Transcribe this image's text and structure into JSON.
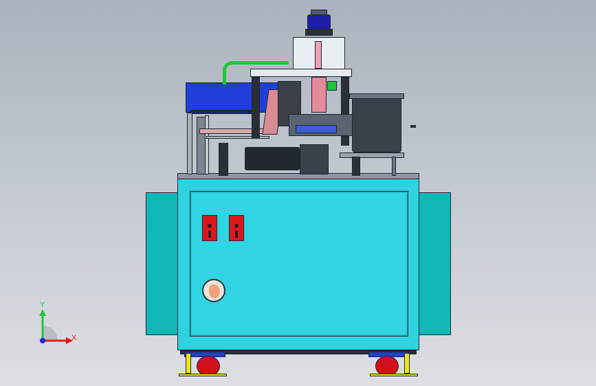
{
  "viewport": {
    "name": "cad-machine-front-view",
    "background_top": "#aab2bd",
    "background_bottom": "#dcdfe3"
  },
  "colors": {
    "cabinet": "#2fd3e0",
    "side_panel": "#12b7b7",
    "frame_blue": "#1f3fd8",
    "hose_green": "#21c63a",
    "switch_red": "#e0161d",
    "wheel_red": "#d0101a",
    "caster_yellow": "#efe418"
  },
  "axes": {
    "y_label": "Y",
    "x_label": "X",
    "y_color": "#21c63a",
    "x_color": "#e01a1a",
    "z_color": "#1f2bd8"
  },
  "icons": {
    "switches": [
      "red-switch-icon",
      "red-switch-icon"
    ],
    "knob": "rotary-knob-icon"
  }
}
